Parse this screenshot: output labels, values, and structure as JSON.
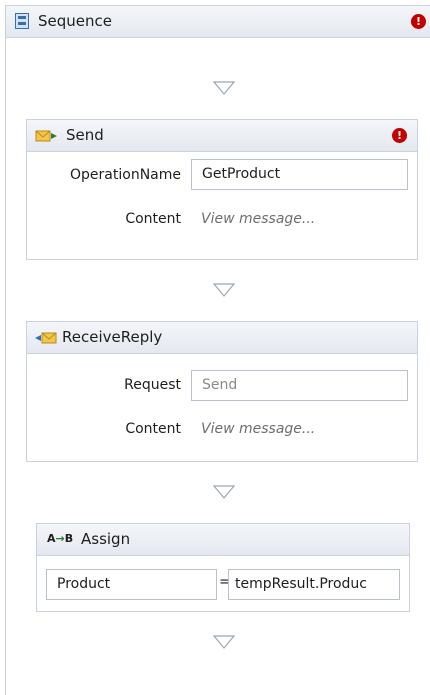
{
  "sequence": {
    "title": "Sequence",
    "has_error": true
  },
  "send": {
    "title": "Send",
    "has_error": true,
    "operation_label": "OperationName",
    "operation_value": "GetProduct",
    "content_label": "Content",
    "content_link": "View message..."
  },
  "receive": {
    "title": "ReceiveReply",
    "request_label": "Request",
    "request_value": "Send",
    "content_label": "Content",
    "content_link": "View message..."
  },
  "assign": {
    "title": "Assign",
    "to_value": "Product",
    "equals": "=",
    "value": "tempResult.Produc"
  },
  "icons": {
    "sequence": "sequence-icon",
    "send": "send-envelope-icon",
    "receive": "receive-envelope-icon",
    "assign": "assign-icon",
    "error": "error-icon",
    "drop": "drop-arrow-icon"
  },
  "colors": {
    "error": "#c30000",
    "header": "#e8ecf2",
    "border": "#c9d2df"
  }
}
